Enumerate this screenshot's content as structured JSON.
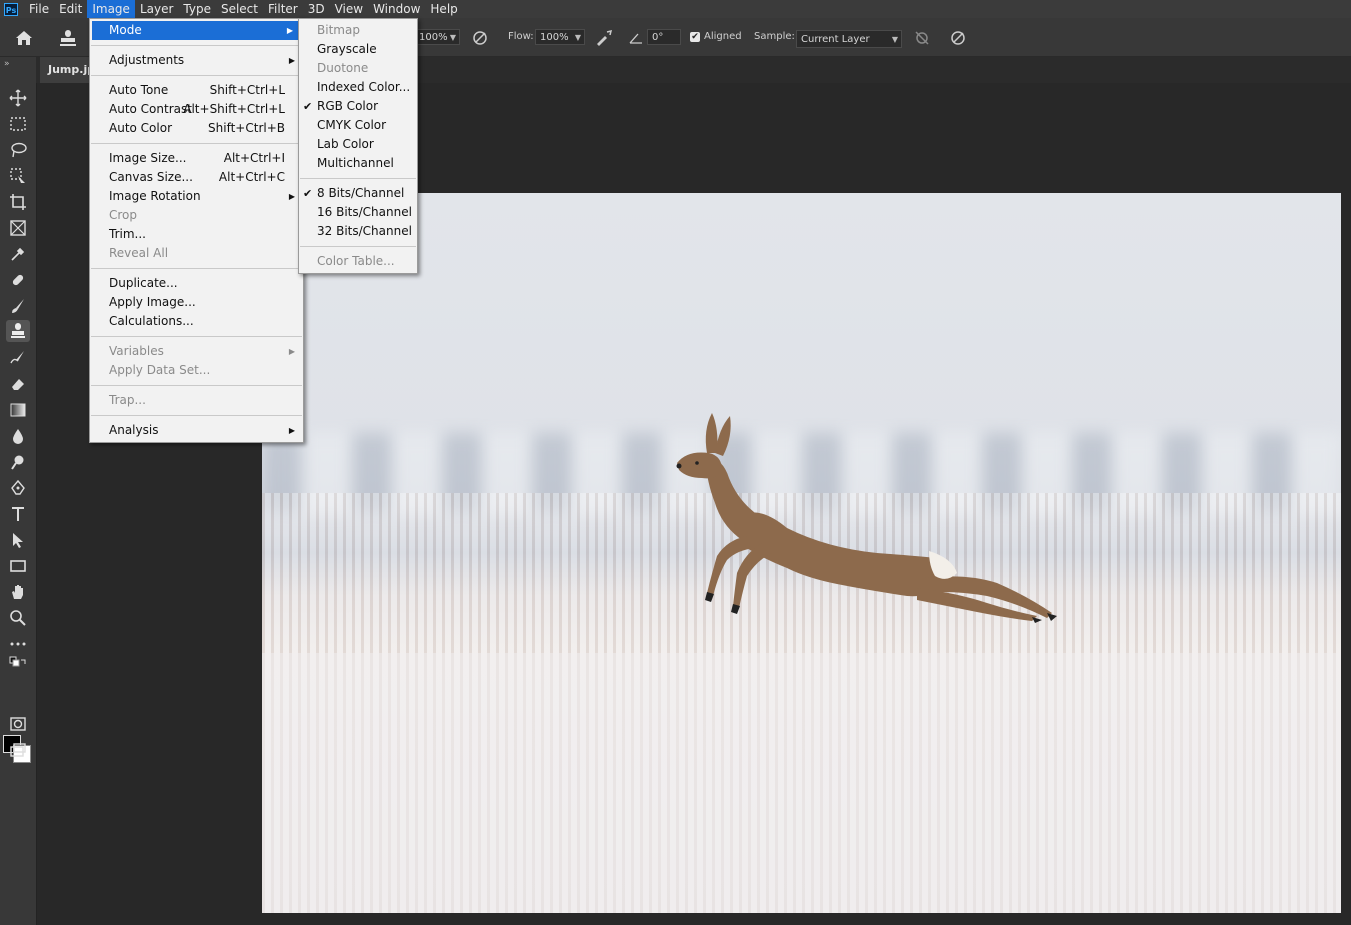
{
  "app": {
    "logo_text": "Ps"
  },
  "menubar": [
    {
      "label": "File"
    },
    {
      "label": "Edit"
    },
    {
      "label": "Image",
      "active": true
    },
    {
      "label": "Layer"
    },
    {
      "label": "Type"
    },
    {
      "label": "Select"
    },
    {
      "label": "Filter"
    },
    {
      "label": "3D"
    },
    {
      "label": "View"
    },
    {
      "label": "Window"
    },
    {
      "label": "Help"
    }
  ],
  "options": {
    "opacity_value": "100%",
    "flow_label": "Flow:",
    "flow_value": "100%",
    "angle_value": "0°",
    "aligned_label": "Aligned",
    "aligned_checked": true,
    "sample_label": "Sample:",
    "sample_value": "Current Layer"
  },
  "document": {
    "tab_title": "Jump.jp"
  },
  "image_menu": {
    "mode": "Mode",
    "adjustments": "Adjustments",
    "auto_tone": "Auto Tone",
    "auto_tone_sc": "Shift+Ctrl+L",
    "auto_contrast": "Auto Contrast",
    "auto_contrast_sc": "Alt+Shift+Ctrl+L",
    "auto_color": "Auto Color",
    "auto_color_sc": "Shift+Ctrl+B",
    "image_size": "Image Size...",
    "image_size_sc": "Alt+Ctrl+I",
    "canvas_size": "Canvas Size...",
    "canvas_size_sc": "Alt+Ctrl+C",
    "image_rotation": "Image Rotation",
    "crop": "Crop",
    "trim": "Trim...",
    "reveal_all": "Reveal All",
    "duplicate": "Duplicate...",
    "apply_image": "Apply Image...",
    "calculations": "Calculations...",
    "variables": "Variables",
    "apply_data_set": "Apply Data Set...",
    "trap": "Trap...",
    "analysis": "Analysis"
  },
  "mode_menu": {
    "bitmap": "Bitmap",
    "grayscale": "Grayscale",
    "duotone": "Duotone",
    "indexed_color": "Indexed Color...",
    "rgb_color": "RGB Color",
    "cmyk_color": "CMYK Color",
    "lab_color": "Lab Color",
    "multichannel": "Multichannel",
    "bits8": "8 Bits/Channel",
    "bits16": "16 Bits/Channel",
    "bits32": "32 Bits/Channel",
    "color_table": "Color Table..."
  },
  "colors": {
    "accent": "#1b6ed6",
    "foreground_swatch": "#000000",
    "background_swatch": "#ffffff"
  }
}
